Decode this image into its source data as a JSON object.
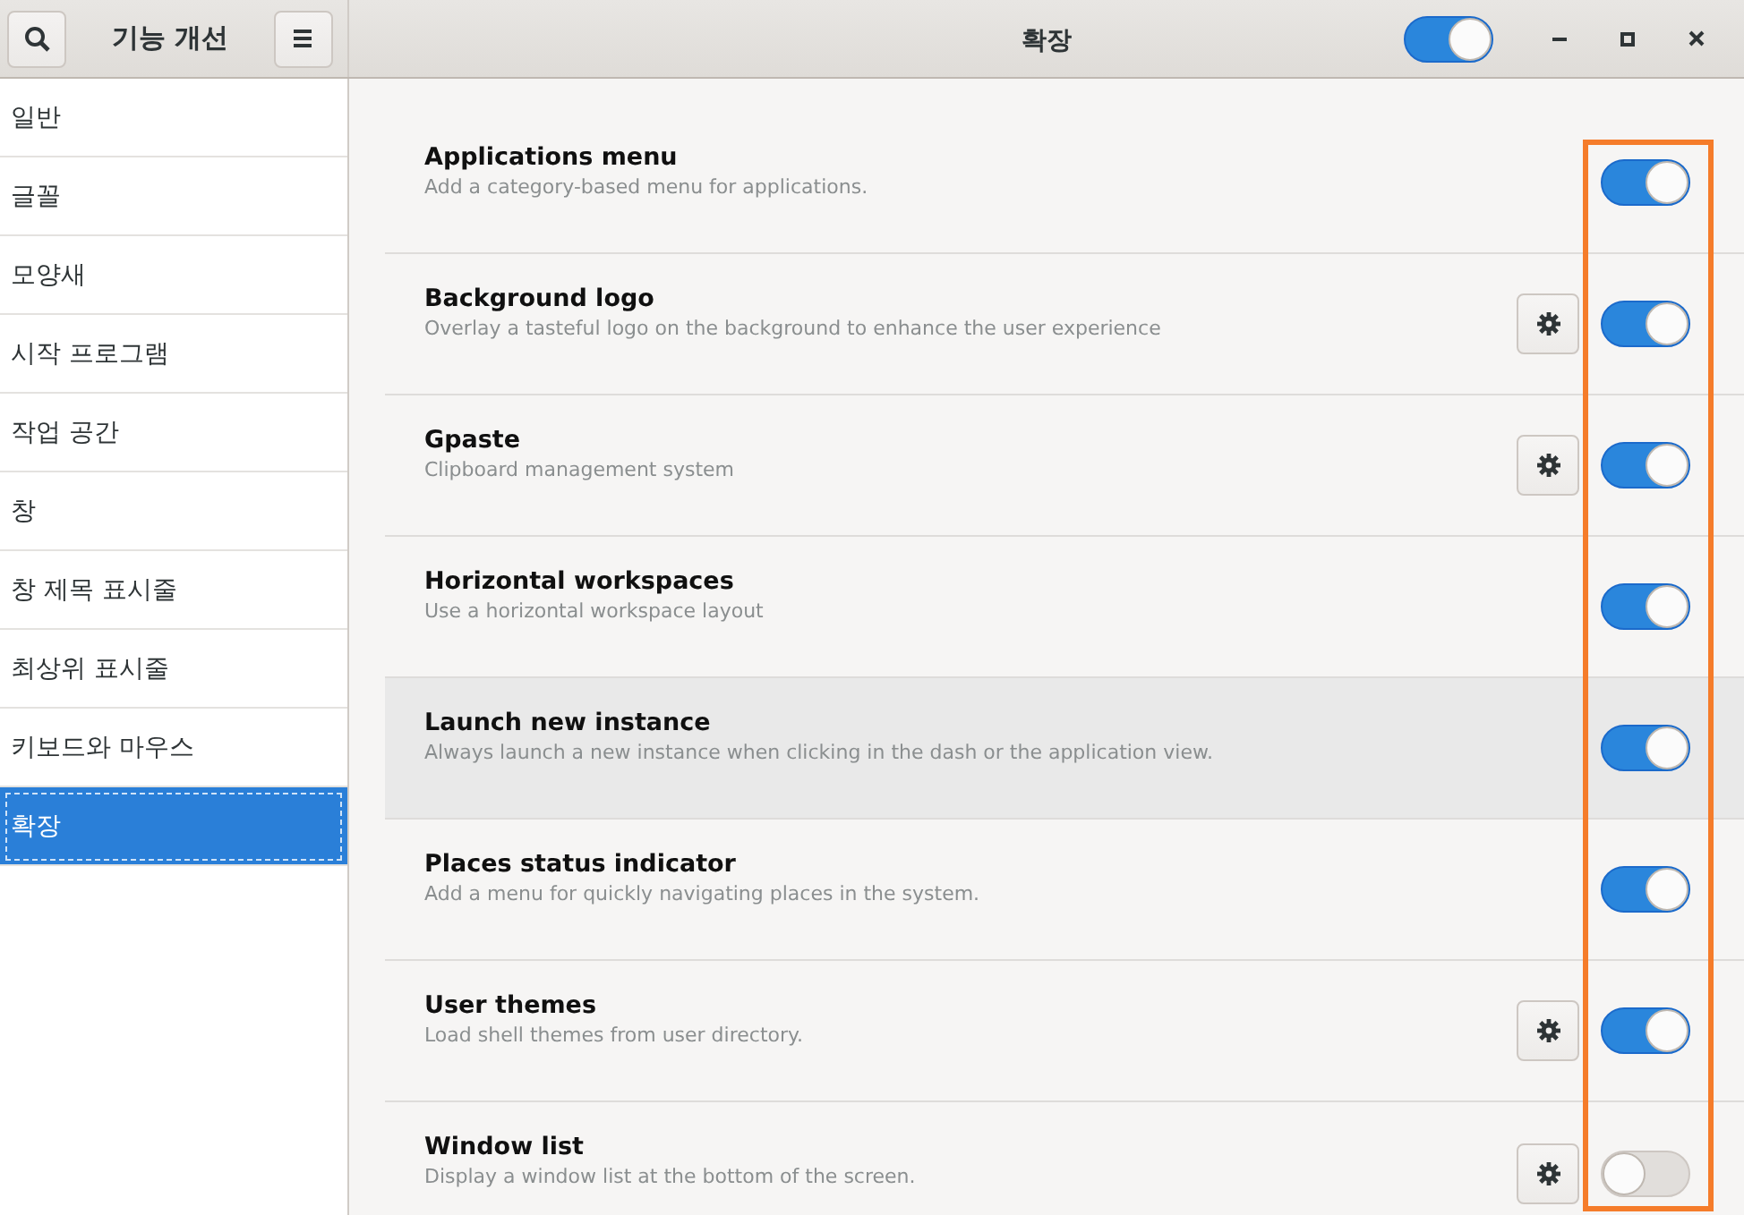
{
  "sidebar_header": {
    "title": "기능 개선"
  },
  "header": {
    "title": "확장",
    "master_switch": {
      "on": true
    }
  },
  "sidebar": {
    "items": [
      {
        "label": "일반",
        "selected": false
      },
      {
        "label": "글꼴",
        "selected": false
      },
      {
        "label": "모양새",
        "selected": false
      },
      {
        "label": "시작 프로그램",
        "selected": false
      },
      {
        "label": "작업 공간",
        "selected": false
      },
      {
        "label": "창",
        "selected": false
      },
      {
        "label": "창 제목 표시줄",
        "selected": false
      },
      {
        "label": "최상위 표시줄",
        "selected": false
      },
      {
        "label": "키보드와 마우스",
        "selected": false
      },
      {
        "label": "확장",
        "selected": true
      }
    ]
  },
  "extensions": [
    {
      "name": "Applications menu",
      "description": "Add a category-based menu for applications.",
      "has_settings": false,
      "on": true,
      "hovered": false
    },
    {
      "name": "Background logo",
      "description": "Overlay a tasteful logo on the background to enhance the user experience",
      "has_settings": true,
      "on": true,
      "hovered": false
    },
    {
      "name": "Gpaste",
      "description": "Clipboard management system",
      "has_settings": true,
      "on": true,
      "hovered": false
    },
    {
      "name": "Horizontal workspaces",
      "description": "Use a horizontal workspace layout",
      "has_settings": false,
      "on": true,
      "hovered": false
    },
    {
      "name": "Launch new instance",
      "description": "Always launch a new instance when clicking in the dash or the application view.",
      "has_settings": false,
      "on": true,
      "hovered": true
    },
    {
      "name": "Places status indicator",
      "description": "Add a menu for quickly navigating places in the system.",
      "has_settings": false,
      "on": true,
      "hovered": false
    },
    {
      "name": "User themes",
      "description": "Load shell themes from user directory.",
      "has_settings": true,
      "on": true,
      "hovered": false
    },
    {
      "name": "Window list",
      "description": "Display a window list at the bottom of the screen.",
      "has_settings": true,
      "on": false,
      "hovered": false
    }
  ],
  "annotation": {
    "kind": "frame"
  }
}
